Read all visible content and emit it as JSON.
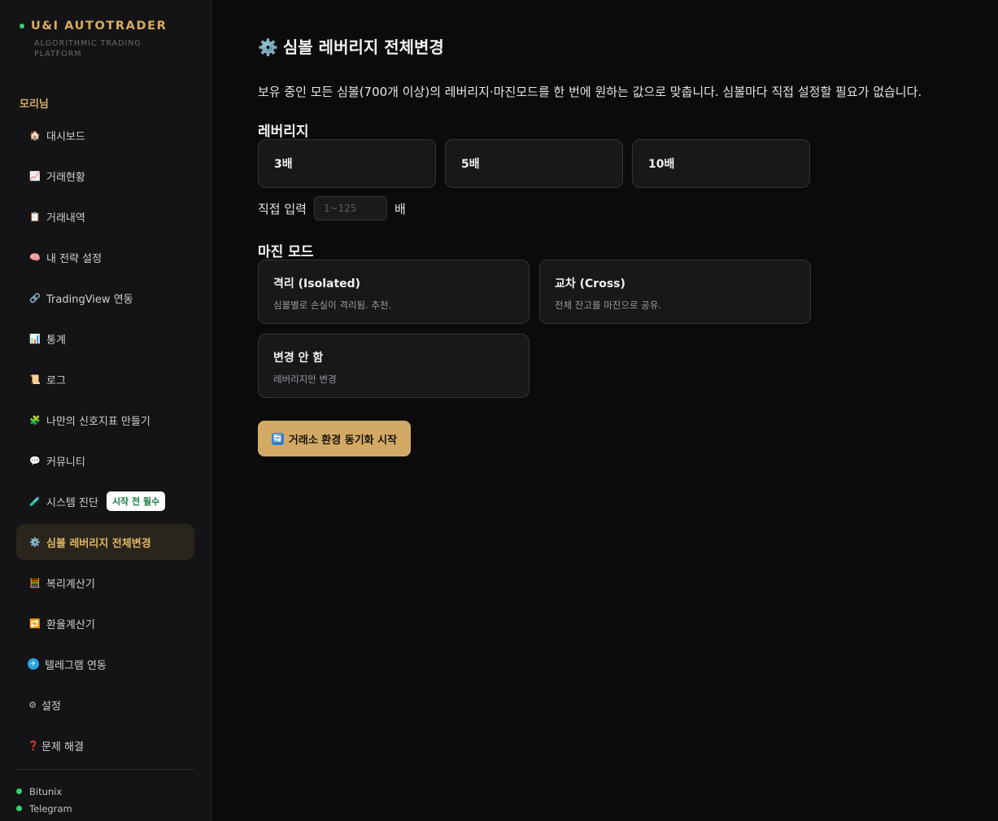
{
  "brand": {
    "title": "U&I AUTOTRADER",
    "subtitle": "ALGORITHMIC TRADING PLATFORM"
  },
  "user": {
    "name": "모리님"
  },
  "nav": [
    {
      "icon": "🏠",
      "icon_name": "home-icon",
      "label": "대시보드"
    },
    {
      "icon": "📈",
      "icon_name": "chart-up-icon",
      "label": "거래현황"
    },
    {
      "icon": "📋",
      "icon_name": "clipboard-icon",
      "label": "거래내역"
    },
    {
      "icon": "🧠",
      "icon_name": "brain-icon",
      "label": "내 전략 설정"
    },
    {
      "icon": "🔗",
      "icon_name": "link-icon",
      "label": "TradingView 연동"
    },
    {
      "icon": "📊",
      "icon_name": "bar-chart-icon",
      "label": "통계"
    },
    {
      "icon": "📜",
      "icon_name": "scroll-icon",
      "label": "로그"
    },
    {
      "icon": "🧩",
      "icon_name": "puzzle-icon",
      "label": "나만의 신호지표 만들기"
    },
    {
      "icon": "💬",
      "icon_name": "chat-icon",
      "label": "커뮤니티"
    },
    {
      "icon": "🧪",
      "icon_name": "test-tube-icon",
      "label": "시스템 진단",
      "badge": "시작 전 필수"
    },
    {
      "icon": "⚙️",
      "icon_name": "gear-icon",
      "label": "심볼 레버리지 전체변경",
      "active": true
    },
    {
      "icon": "🧮",
      "icon_name": "abacus-icon",
      "label": "복리계산기"
    },
    {
      "icon": "🔁",
      "icon_name": "repeat-icon",
      "label": "환율계산기"
    },
    {
      "icon": "✈",
      "icon_name": "telegram-icon",
      "label": "텔레그램 연동"
    },
    {
      "icon": "⚙",
      "icon_name": "settings-icon",
      "label": "설정"
    },
    {
      "icon": "❓",
      "icon_name": "question-icon",
      "label": "문제 해결"
    }
  ],
  "status": [
    {
      "label": "Bitunix",
      "color": "#38d26a"
    },
    {
      "label": "Telegram",
      "color": "#38d26a"
    }
  ],
  "page": {
    "title_icon": "⚙️",
    "title": "심볼 레버리지 전체변경",
    "description": "보유 중인 모든 심볼(700개 이상)의 레버리지·마진모드를 한 번에 원하는 값으로 맞춥니다. 심볼마다 직접 설정할 필요가 없습니다."
  },
  "leverage": {
    "label": "레버리지",
    "options": [
      "3배",
      "5배",
      "10배"
    ],
    "custom_label": "직접 입력",
    "custom_placeholder": "1~125",
    "custom_value": "",
    "unit": "배"
  },
  "margin_mode": {
    "label": "마진 모드",
    "options": [
      {
        "title": "격리 (Isolated)",
        "desc": "심볼별로 손실이 격리됨. 추천."
      },
      {
        "title": "교차 (Cross)",
        "desc": "전체 잔고를 마진으로 공유."
      },
      {
        "title": "변경 안 함",
        "desc": "레버리지만 변경"
      }
    ]
  },
  "sync_button": {
    "icon": "🔄",
    "label": "거래소 환경 동기화 시작"
  },
  "colors": {
    "accent": "#d9ad5e",
    "button": "#d3aa65",
    "status_green": "#38d26a",
    "badge_text": "#137a3a",
    "active_bg": "#2a251c"
  }
}
